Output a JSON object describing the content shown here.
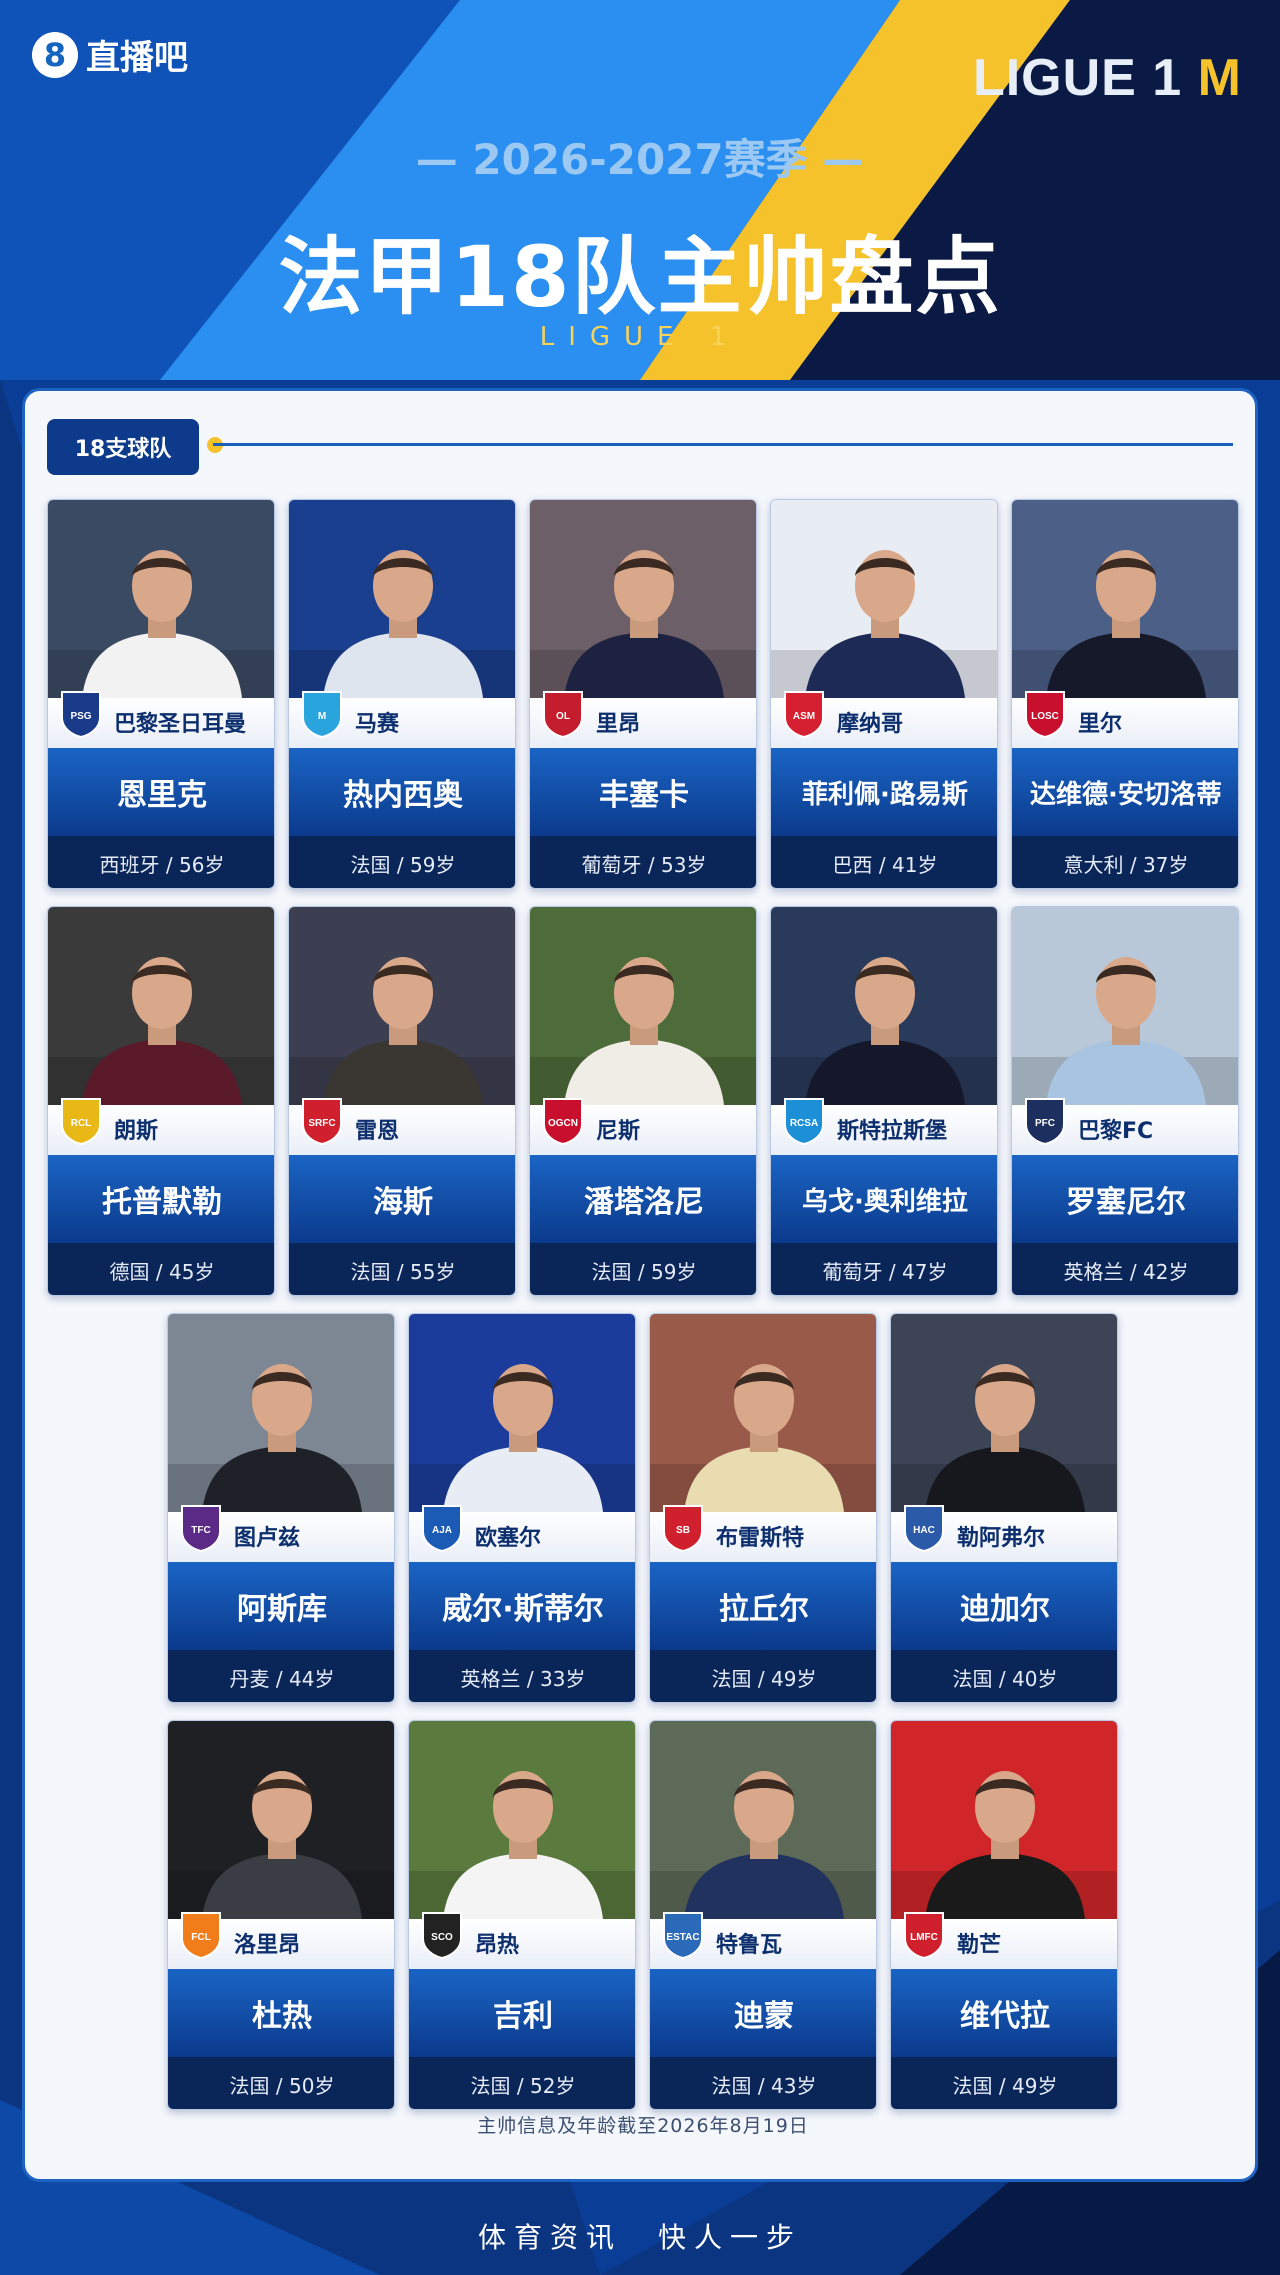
{
  "header": {
    "brand_mark": "8",
    "brand_text": "直播吧",
    "league_logo_text": "LIGUE 1",
    "league_logo_mark": "M",
    "season": "— 2026-2027赛季 —",
    "title": "法甲18队主帅盘点",
    "subtitle": "LIGUE 1"
  },
  "section": {
    "label": "18支球队"
  },
  "colors": {
    "brand_blue": "#0b3a8c",
    "accent_light_blue": "#2196f3",
    "accent_yellow": "#f6c22c",
    "panel_bg": "#f4f7fc"
  },
  "cards": [
    {
      "club": "巴黎圣日耳曼",
      "coach": "恩里克",
      "info": "西班牙 / 56岁",
      "badge_color": "#1a3b8a",
      "badge_text": "PSG",
      "photo_bg": "#3b4a63",
      "shirt": "#f2f2f2"
    },
    {
      "club": "马赛",
      "coach": "热内西奥",
      "info": "法国 / 59岁",
      "badge_color": "#2aa4dc",
      "badge_text": "M",
      "photo_bg": "#1a3f8f",
      "shirt": "#dfe5ef"
    },
    {
      "club": "里昂",
      "coach": "丰塞卡",
      "info": "葡萄牙 / 53岁",
      "badge_color": "#c41e2e",
      "badge_text": "OL",
      "photo_bg": "#6c5f68",
      "shirt": "#1d2240"
    },
    {
      "club": "摩纳哥",
      "coach": "菲利佩·路易斯",
      "info": "巴西 / 41岁",
      "badge_color": "#d42030",
      "badge_text": "ASM",
      "photo_bg": "#e8ecf3",
      "shirt": "#1c2a55"
    },
    {
      "club": "里尔",
      "coach": "达维德·安切洛蒂",
      "info": "意大利 / 37岁",
      "badge_color": "#c8102e",
      "badge_text": "LOSC",
      "photo_bg": "#4c5f86",
      "shirt": "#15192a"
    },
    {
      "club": "朗斯",
      "coach": "托普默勒",
      "info": "德国 / 45岁",
      "badge_color": "#e8b817",
      "badge_text": "RCL",
      "photo_bg": "#3a3a3a",
      "shirt": "#5a1a2a"
    },
    {
      "club": "雷恩",
      "coach": "海斯",
      "info": "法国 / 55岁",
      "badge_color": "#d0202d",
      "badge_text": "SRFC",
      "photo_bg": "#3c3f52",
      "shirt": "#3a3632"
    },
    {
      "club": "尼斯",
      "coach": "潘塔洛尼",
      "info": "法国 / 59岁",
      "badge_color": "#c8102e",
      "badge_text": "OGCN",
      "photo_bg": "#4e6b3a",
      "shirt": "#f0ece6"
    },
    {
      "club": "斯特拉斯堡",
      "coach": "乌戈·奥利维拉",
      "info": "葡萄牙 / 47岁",
      "badge_color": "#1d8fd6",
      "badge_text": "RCSA",
      "photo_bg": "#2a3a5a",
      "shirt": "#14182a"
    },
    {
      "club": "巴黎FC",
      "coach": "罗塞尼尔",
      "info": "英格兰 / 42岁",
      "badge_color": "#1c2f5e",
      "badge_text": "PFC",
      "photo_bg": "#b8c8d8",
      "shirt": "#a8c4e0"
    },
    {
      "club": "图卢兹",
      "coach": "阿斯库",
      "info": "丹麦 / 44岁",
      "badge_color": "#5a2a86",
      "badge_text": "TFC",
      "photo_bg": "#7d8794",
      "shirt": "#1e2228"
    },
    {
      "club": "欧塞尔",
      "coach": "威尔·斯蒂尔",
      "info": "英格兰 / 33岁",
      "badge_color": "#1c5bb5",
      "badge_text": "AJA",
      "photo_bg": "#1c3c9c",
      "shirt": "#e8edf5"
    },
    {
      "club": "布雷斯特",
      "coach": "拉丘尔",
      "info": "法国 / 49岁",
      "badge_color": "#d0202d",
      "badge_text": "SB",
      "photo_bg": "#9a5a4a",
      "shirt": "#e8dcb0"
    },
    {
      "club": "勒阿弗尔",
      "coach": "迪加尔",
      "info": "法国 / 40岁",
      "badge_color": "#2a5aa8",
      "badge_text": "HAC",
      "photo_bg": "#3c4456",
      "shirt": "#16181e"
    },
    {
      "club": "洛里昂",
      "coach": "杜热",
      "info": "法国 / 50岁",
      "badge_color": "#f07c1a",
      "badge_text": "FCL",
      "photo_bg": "#1e2024",
      "shirt": "#3a3e44"
    },
    {
      "club": "昂热",
      "coach": "吉利",
      "info": "法国 / 52岁",
      "badge_color": "#222222",
      "badge_text": "SCO",
      "photo_bg": "#5a7a3e",
      "shirt": "#f4f4f4"
    },
    {
      "club": "特鲁瓦",
      "coach": "迪蒙",
      "info": "法国 / 43岁",
      "badge_color": "#2a6ab8",
      "badge_text": "ESTAC",
      "photo_bg": "#5e6a58",
      "shirt": "#22325e"
    },
    {
      "club": "勒芒",
      "coach": "维代拉",
      "info": "法国 / 49岁",
      "badge_color": "#d0202d",
      "badge_text": "LMFC",
      "photo_bg": "#d0262a",
      "shirt": "#1a1a1a"
    }
  ],
  "footnote": "主帅信息及年龄截至2026年8月19日",
  "slogan": "体育资讯　快人一步"
}
